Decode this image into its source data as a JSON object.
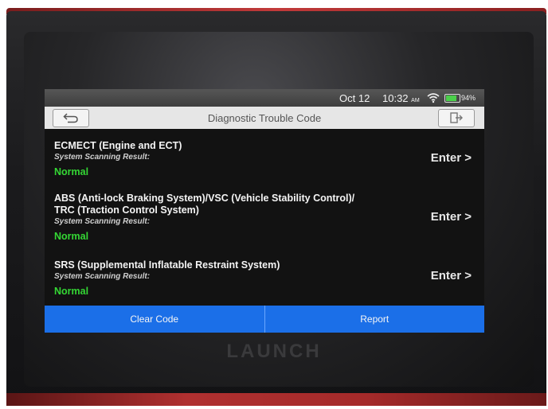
{
  "brand": "LAUNCH",
  "status_bar": {
    "date": "Oct 12",
    "time": "10:32",
    "ampm": "AM",
    "battery": "94%",
    "battery_level": 0.94
  },
  "header": {
    "title": "Diagnostic Trouble Code",
    "back_icon": "back-arrow-icon",
    "exit_icon": "exit-icon"
  },
  "systems": [
    {
      "title_line1": "ECMECT (Engine and ECT)",
      "title_line2": "",
      "result_label": "System Scanning Result:",
      "result": "Normal",
      "action": "Enter >"
    },
    {
      "title_line1": "ABS (Anti-lock Braking System)/VSC (Vehicle Stability Control)/",
      "title_line2": "TRC (Traction Control System)",
      "result_label": "System Scanning Result:",
      "result": "Normal",
      "action": "Enter >"
    },
    {
      "title_line1": "SRS (Supplemental Inflatable Restraint System)",
      "title_line2": "",
      "result_label": "System Scanning Result:",
      "result": "Normal",
      "action": "Enter >"
    }
  ],
  "footer": {
    "clear_code": "Clear Code",
    "report": "Report"
  },
  "colors": {
    "accent": "#1b6fe8",
    "status_ok": "#34d734"
  }
}
